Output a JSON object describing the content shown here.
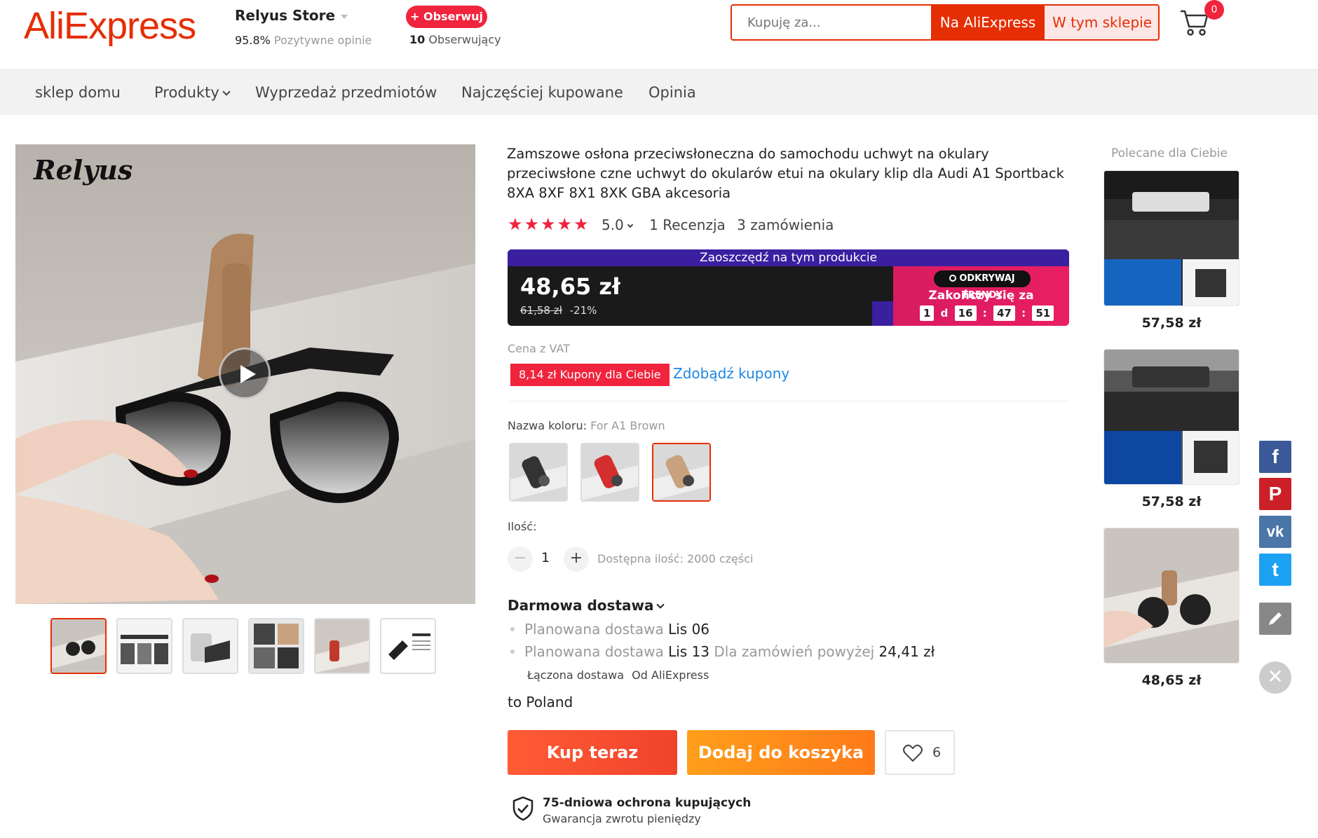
{
  "header": {
    "logo": "AliExpress",
    "store_name": "Relyus Store",
    "store_rating_value": "95.8%",
    "store_rating_label": "Pozytywne opinie",
    "follow_label": "+ Obserwuj",
    "followers_count": "10",
    "followers_label": "Obserwujący",
    "search_placeholder": "Kupuję za...",
    "search_all_label": "Na AliExpress",
    "search_store_label": "W tym sklepie",
    "cart_count": "0"
  },
  "nav": {
    "items": [
      "sklep domu",
      "Produkty",
      "Wyprzedaż przedmiotów",
      "Najczęściej kupowane",
      "Opinia"
    ]
  },
  "gallery": {
    "brand_watermark": "Relyus",
    "thumbnail_count": 6,
    "active_thumbnail": 1
  },
  "product": {
    "title": "Zamszowe osłona przeciwsłoneczna do samochodu uchwyt na okulary przeciwsłone czne uchwyt do okularów etui na okulary klip dla Audi A1 Sportback 8XA 8XF 8X1 8XK GBA akcesoria",
    "stars": "★★★★★",
    "rating": "5.0",
    "reviews": "1 Recenzja",
    "orders": "3 zamówienia",
    "promo_header": "Zaoszczędź na tym produkcie",
    "price": "48,65 zł",
    "old_price": "61,58 zł",
    "discount": "-21%",
    "promo_badge": "ODKRYWAJ TRENDY",
    "promo_ends": "Zakończy się za",
    "countdown": {
      "days": "1",
      "day_unit": "d",
      "hours": "16",
      "minutes": "47",
      "seconds": "51"
    },
    "vat_label": "Cena z VAT",
    "coupon_tag": "8,14 zł Kupony dla Ciebie",
    "coupon_link": "Zdobądź kupony",
    "color_label": "Nazwa koloru:",
    "color_value": "For A1 Brown",
    "color_options": [
      "Black",
      "Red",
      "Brown"
    ],
    "selected_color": "Brown",
    "qty_label": "Ilość:",
    "qty_value": "1",
    "qty_available": "Dostępna ilość: 2000 części",
    "shipping_title": "Darmowa dostawa",
    "ship_line1_label": "Planowana dostawa",
    "ship_line1_date": "Lis 06",
    "ship_line2_label": "Planowana dostawa",
    "ship_line2_date": "Lis 13",
    "ship_line2_cond": "Dla zamówień powyżej",
    "ship_line2_amount": "24,41 zł",
    "combined_label": "Łączona dostawa",
    "combined_from": "Od AliExpress",
    "destination": "to Poland",
    "buy_now_label": "Kup teraz",
    "add_cart_label": "Dodaj do koszyka",
    "wishlist_count": "6",
    "protection_title": "75-dniowa ochrona kupujących",
    "protection_sub": "Gwarancja zwrotu pieniędzy"
  },
  "recommended": {
    "title": "Polecane dla Ciebie",
    "items": [
      {
        "price": "57,58 zł"
      },
      {
        "price": "57,58 zł"
      },
      {
        "price": "48,65 zł"
      }
    ]
  },
  "social": {
    "facebook_glyph": "f",
    "pinterest_glyph": "P",
    "vk_glyph": "vk",
    "twitter_glyph": "t",
    "close_glyph": "✕"
  },
  "colors": {
    "brand_red": "#e62e04",
    "promo_purple": "#3a1fa0",
    "promo_pink": "#e91e63",
    "buy_orange": "#f0432c",
    "cart_orange": "#ff9f1a",
    "link_blue": "#1e88e5",
    "facebook": "#3b5998",
    "pinterest": "#cb2027",
    "vk": "#4a76a8",
    "twitter": "#1da1f2",
    "edit": "#888888"
  }
}
